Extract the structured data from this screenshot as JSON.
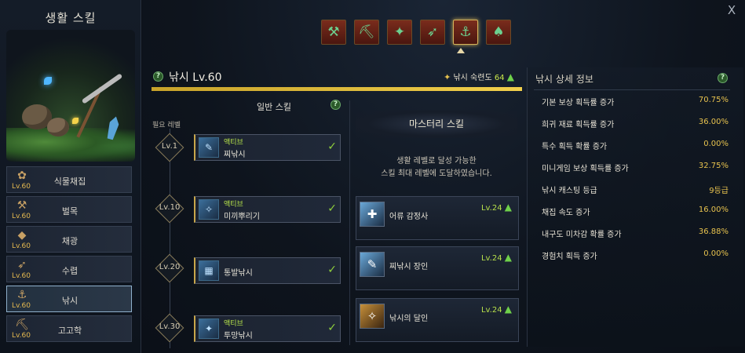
{
  "left": {
    "title": "생활 스킬",
    "items": [
      {
        "name": "식물채집",
        "level": "Lv.60",
        "icon": "✿"
      },
      {
        "name": "벌목",
        "level": "Lv.60",
        "icon": "⚒"
      },
      {
        "name": "채광",
        "level": "Lv.60",
        "icon": "◆"
      },
      {
        "name": "수렵",
        "level": "Lv.60",
        "icon": "➶"
      },
      {
        "name": "낚시",
        "level": "Lv.60",
        "icon": "⚓"
      },
      {
        "name": "고고학",
        "level": "Lv.60",
        "icon": "⛏"
      }
    ]
  },
  "close_label": "X",
  "tools": [
    "⚒",
    "⛏",
    "✦",
    "➶",
    "⚓",
    "♠"
  ],
  "header": {
    "help": "?",
    "title": "낚시 Lv.60",
    "proficiency_label": "낚시 숙련도",
    "proficiency_value": "64",
    "proficiency_fraction": 1.0
  },
  "normal": {
    "title": "일반 스킬",
    "required_level": "필요 레벨",
    "skills": [
      {
        "level": "Lv.1",
        "tag": "액티브",
        "name": "찌낚시",
        "icon": "✎",
        "checked": "✓"
      },
      {
        "level": "Lv.10",
        "tag": "액티브",
        "name": "미끼뿌리기",
        "icon": "✧",
        "checked": "✓"
      },
      {
        "level": "Lv.20",
        "tag": "",
        "name": "통발낚시",
        "icon": "▦",
        "checked": "✓"
      },
      {
        "level": "Lv.30",
        "tag": "액티브",
        "name": "투망낚시",
        "icon": "✦",
        "checked": "✓"
      }
    ]
  },
  "mastery": {
    "title": "마스터리 스킬",
    "desc_line1": "생활 레벨로 달성 가능한",
    "desc_line2": "스킬 최대 레벨에 도달하였습니다.",
    "skills": [
      {
        "name": "어류 감정사",
        "level": "Lv.24",
        "icon": "✚"
      },
      {
        "name": "찌낚시 장인",
        "level": "Lv.24",
        "icon": "✎"
      },
      {
        "name": "낚시의 달인",
        "level": "Lv.24",
        "icon": "✧"
      }
    ]
  },
  "detail": {
    "title": "낚시 상세 정보",
    "stats": [
      {
        "label": "기본 보상 획득률 증가",
        "value": "70.75%"
      },
      {
        "label": "희귀 재료 획득률 증가",
        "value": "36.00%"
      },
      {
        "label": "특수 획득 확률 증가",
        "value": "0.00%"
      },
      {
        "label": "미니게임 보상 획득률 증가",
        "value": "32.75%"
      },
      {
        "label": "낚시 캐스팅 등급",
        "value": "9등급"
      },
      {
        "label": "채집 속도 증가",
        "value": "16.00%"
      },
      {
        "label": "내구도 미차감 확률 증가",
        "value": "36.88%"
      },
      {
        "label": "경험치 획득 증가",
        "value": "0.00%"
      }
    ]
  },
  "colors": {
    "accent_gold": "#e7c24e",
    "level_green": "#b7e04a",
    "progress_yellow": "#f2d04c"
  }
}
